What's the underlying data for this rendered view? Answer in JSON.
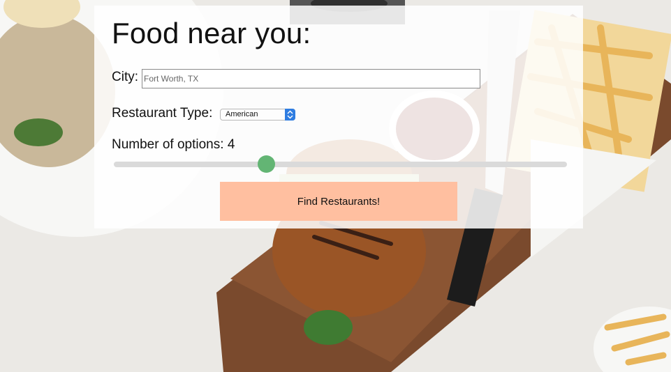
{
  "header": {
    "title": "Food near you:"
  },
  "form": {
    "city_label": "City:",
    "city_value": "Fort Worth, TX",
    "type_label": "Restaurant Type:",
    "type_selected": "American",
    "options_label": "Number of options:",
    "options_value": 4,
    "slider_fraction": 0.34,
    "button_label": "Find Restaurants!"
  },
  "colors": {
    "button": "#ffbfa0",
    "slider_thumb": "#63b574",
    "select_arrow": "#2f7de1"
  },
  "background": {
    "description_icon": "food-photo-background"
  }
}
